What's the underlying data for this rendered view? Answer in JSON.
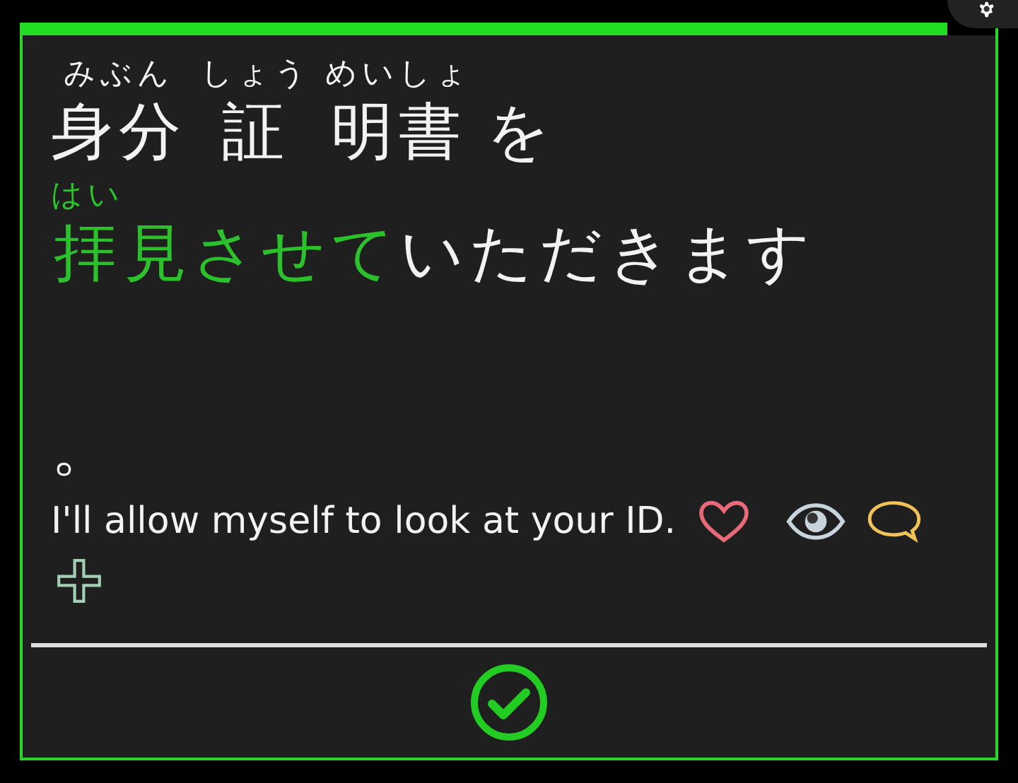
{
  "progress": {
    "level": 0.95
  },
  "sentence_lines": [
    {
      "segments": [
        {
          "text": "身分",
          "ruby": "みぶん",
          "highlight": false
        },
        {
          "text": "証",
          "ruby": "しょう",
          "highlight": false
        },
        {
          "text": "明書",
          "ruby": "めいしょ",
          "highlight": false
        },
        {
          "text": "を",
          "highlight": false
        }
      ]
    },
    {
      "segments": [
        {
          "text": "拝",
          "ruby": "はい",
          "highlight": true
        },
        {
          "text": "見させて",
          "highlight": true
        },
        {
          "text": "いただきます",
          "highlight": false
        }
      ]
    },
    {
      "segments": [
        {
          "text": "。",
          "highlight": false
        }
      ]
    }
  ],
  "translation": "I'll allow myself to look at your ID.",
  "actions": [
    {
      "kind": "heart"
    },
    {
      "kind": "eye"
    },
    {
      "kind": "comment"
    },
    {
      "kind": "add"
    }
  ]
}
